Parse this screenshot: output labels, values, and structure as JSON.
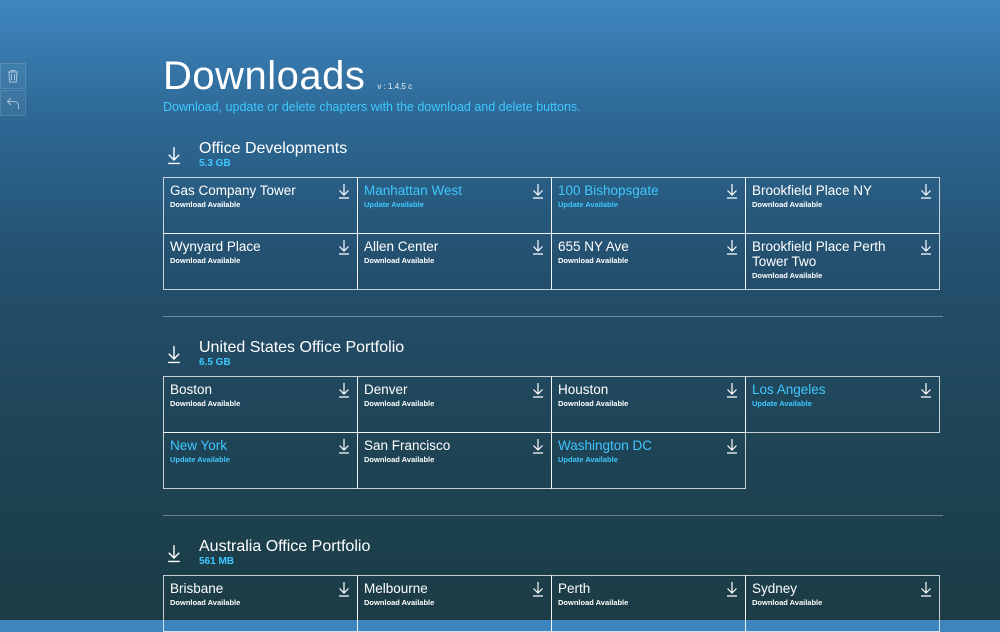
{
  "header": {
    "title": "Downloads",
    "version": "v : 1.4.5 c",
    "subtitle": "Download, update or delete chapters with the download and delete buttons."
  },
  "sidebar": {
    "tools": [
      {
        "icon": "trash-icon"
      },
      {
        "icon": "undo-icon"
      }
    ]
  },
  "sections": [
    {
      "name": "Office Developments",
      "size": "5.3 GB",
      "items": [
        {
          "name": "Gas Company Tower",
          "status": "Download Available",
          "update": false
        },
        {
          "name": "Manhattan West",
          "status": "Update Available",
          "update": true
        },
        {
          "name": "100 Bishopsgate",
          "status": "Update Available",
          "update": true
        },
        {
          "name": "Brookfield Place NY",
          "status": "Download Available",
          "update": false
        },
        {
          "name": "Wynyard Place",
          "status": "Download Available",
          "update": false
        },
        {
          "name": "Allen Center",
          "status": "Download Available",
          "update": false
        },
        {
          "name": "655 NY Ave",
          "status": "Download Available",
          "update": false
        },
        {
          "name": "Brookfield Place Perth Tower Two",
          "status": "Download Available",
          "update": false
        }
      ]
    },
    {
      "name": "United States Office Portfolio",
      "size": "6.5 GB",
      "items": [
        {
          "name": "Boston",
          "status": "Download Available",
          "update": false
        },
        {
          "name": "Denver",
          "status": "Download Available",
          "update": false
        },
        {
          "name": "Houston",
          "status": "Download Available",
          "update": false
        },
        {
          "name": "Los Angeles",
          "status": "Update Available",
          "update": true
        },
        {
          "name": "New York",
          "status": "Update Available",
          "update": true
        },
        {
          "name": "San Francisco",
          "status": "Download Available",
          "update": false
        },
        {
          "name": "Washington DC",
          "status": "Update Available",
          "update": true
        }
      ]
    },
    {
      "name": "Australia Office Portfolio",
      "size": "561 MB",
      "items": [
        {
          "name": "Brisbane",
          "status": "Download Available",
          "update": false
        },
        {
          "name": "Melbourne",
          "status": "Download Available",
          "update": false
        },
        {
          "name": "Perth",
          "status": "Download Available",
          "update": false
        },
        {
          "name": "Sydney",
          "status": "Download Available",
          "update": false
        }
      ]
    }
  ]
}
